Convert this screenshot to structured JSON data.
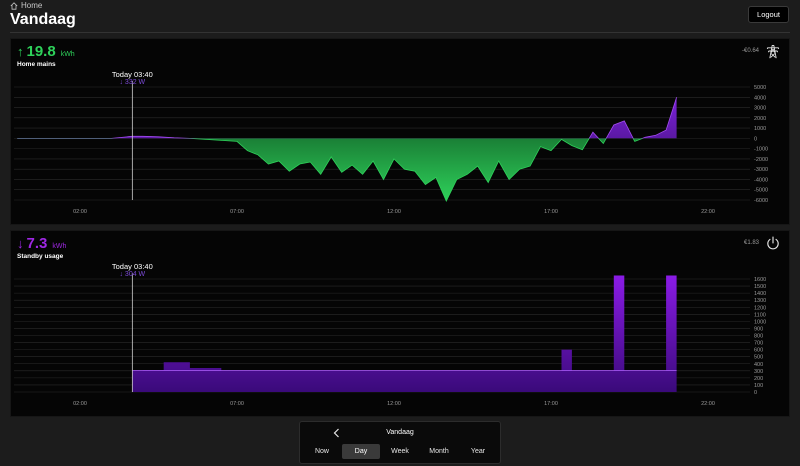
{
  "header": {
    "breadcrumb": "Home",
    "title": "Vandaag",
    "logout_label": "Logout"
  },
  "cards": [
    {
      "key": "mains",
      "arrow": "↑",
      "total_value": "19.8",
      "total_unit": "kWh",
      "label": "Home mains",
      "cost": "-€0.64",
      "icon": "power-pylon-icon",
      "cursor": {
        "time": "Today 03:40",
        "value": "↓ 332 W"
      },
      "color": "#2ed15a"
    },
    {
      "key": "standby",
      "arrow": "↓",
      "total_value": "7.3",
      "total_unit": "kWh",
      "label": "Standby usage",
      "cost": "€1.83",
      "icon": "power-button-icon",
      "cursor": {
        "time": "Today 03:40",
        "value": "↓ 304 W"
      },
      "color": "#9e27e3"
    }
  ],
  "period": {
    "title": "Vandaag",
    "tabs": [
      "Now",
      "Day",
      "Week",
      "Month",
      "Year"
    ],
    "active": "Day"
  },
  "chart_data": [
    {
      "type": "area",
      "series": [
        {
          "x": [
            "00:00",
            "00:30",
            "01:00",
            "01:30",
            "02:00",
            "02:30",
            "03:00",
            "03:40",
            "04:00",
            "04:30",
            "05:00",
            "05:30",
            "06:00",
            "06:30",
            "07:00",
            "07:20",
            "07:40",
            "08:00",
            "08:20",
            "08:40",
            "09:00",
            "09:20",
            "09:40",
            "10:00",
            "10:20",
            "10:40",
            "11:00",
            "11:20",
            "11:40",
            "12:00",
            "12:20",
            "12:40",
            "13:00",
            "13:20",
            "13:40",
            "14:00",
            "14:20",
            "14:40",
            "15:00",
            "15:20",
            "15:40",
            "16:00",
            "16:20",
            "16:40",
            "17:00",
            "17:20",
            "17:40",
            "18:00",
            "18:20",
            "18:40",
            "19:00",
            "19:20",
            "19:40",
            "20:00",
            "20:20",
            "20:40",
            "21:00"
          ],
          "values": [
            0,
            0,
            0,
            0,
            0,
            0,
            0,
            200,
            200,
            150,
            50,
            0,
            -100,
            -200,
            -300,
            -1200,
            -1600,
            -2500,
            -2200,
            -3200,
            -2500,
            -2300,
            -3500,
            -1800,
            -3300,
            -2600,
            -3500,
            -2200,
            -4000,
            -2000,
            -3000,
            -3200,
            -4500,
            -3800,
            -6100,
            -4000,
            -3500,
            -2700,
            -4300,
            -2200,
            -4000,
            -3000,
            -2700,
            -800,
            -1200,
            -100,
            -700,
            -1100,
            600,
            -500,
            1300,
            1700,
            -300,
            100,
            300,
            800,
            4000
          ]
        }
      ],
      "xticks": [
        "02:00",
        "07:00",
        "12:00",
        "17:00",
        "22:00"
      ],
      "ylim": [
        -6000,
        5000
      ],
      "yticks": [
        5000,
        4000,
        3000,
        2000,
        1000,
        0,
        -1000,
        -2000,
        -3000,
        -4000,
        -5000,
        -6000
      ],
      "colors": {
        "import": "#7b22d9",
        "export": "#2ed15a"
      }
    },
    {
      "type": "area",
      "series": [
        {
          "x": [
            "03:40",
            "04:00",
            "04:40",
            "05:30",
            "06:30",
            "07:00",
            "10:00",
            "13:00",
            "16:00",
            "17:00",
            "17:20",
            "17:40",
            "18:00",
            "18:20",
            "18:40",
            "19:00",
            "19:20",
            "19:40",
            "20:00",
            "20:40",
            "21:00"
          ],
          "values": [
            304,
            310,
            420,
            340,
            304,
            304,
            304,
            304,
            304,
            304,
            600,
            304,
            304,
            304,
            304,
            1650,
            304,
            304,
            304,
            1650,
            304
          ]
        }
      ],
      "xticks": [
        "02:00",
        "07:00",
        "12:00",
        "17:00",
        "22:00"
      ],
      "ylim": [
        0,
        1600
      ],
      "yticks": [
        1600,
        1500,
        1400,
        1300,
        1200,
        1100,
        1000,
        900,
        800,
        700,
        600,
        500,
        400,
        300,
        200,
        100,
        0
      ],
      "colors": {
        "fill": "#8a1be6"
      }
    }
  ]
}
